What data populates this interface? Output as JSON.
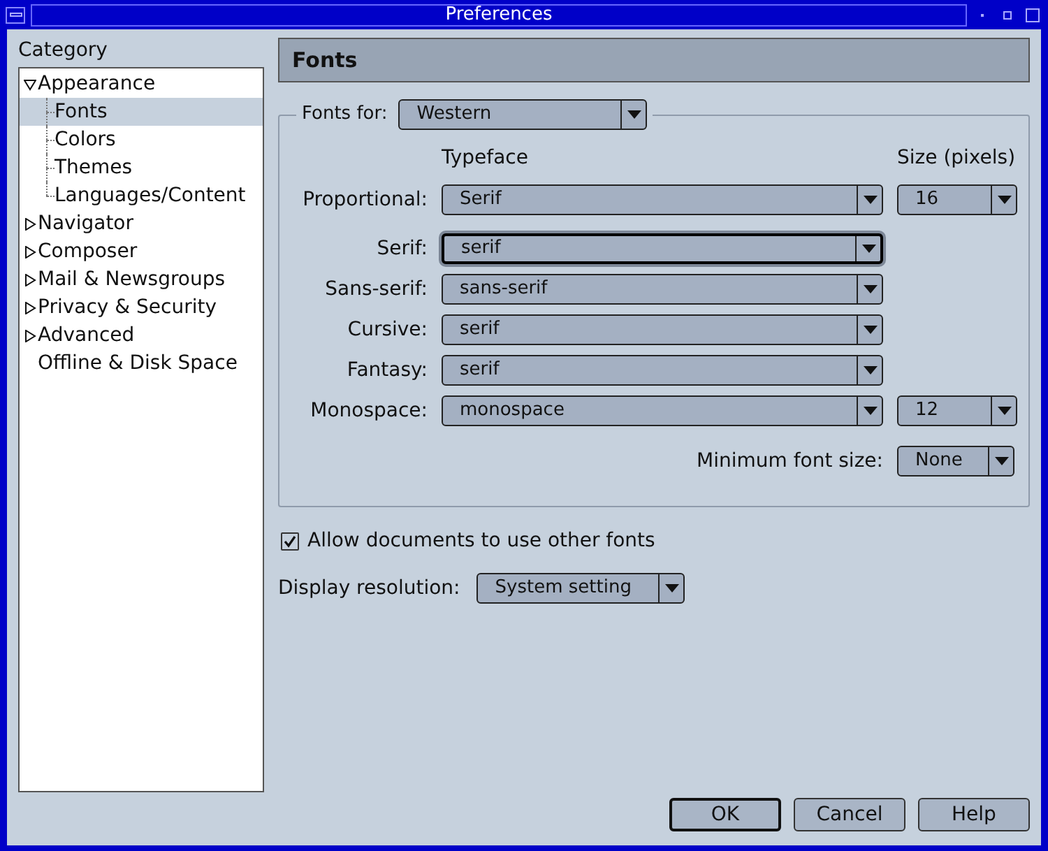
{
  "window": {
    "title": "Preferences"
  },
  "sidebar": {
    "label": "Category",
    "items": [
      {
        "label": "Appearance",
        "kind": "group",
        "expanded": true,
        "selected": false,
        "children": [
          {
            "label": "Fonts",
            "selected": true
          },
          {
            "label": "Colors",
            "selected": false
          },
          {
            "label": "Themes",
            "selected": false
          },
          {
            "label": "Languages/Content",
            "selected": false
          }
        ]
      },
      {
        "label": "Navigator",
        "kind": "group",
        "expanded": false,
        "selected": false
      },
      {
        "label": "Composer",
        "kind": "group",
        "expanded": false,
        "selected": false
      },
      {
        "label": "Mail & Newsgroups",
        "kind": "group",
        "expanded": false,
        "selected": false
      },
      {
        "label": "Privacy & Security",
        "kind": "group",
        "expanded": false,
        "selected": false
      },
      {
        "label": "Advanced",
        "kind": "group",
        "expanded": false,
        "selected": false
      },
      {
        "label": "Offline & Disk Space",
        "kind": "leaf",
        "selected": false
      }
    ]
  },
  "panel": {
    "title": "Fonts",
    "fonts_for": {
      "label": "Fonts for:",
      "value": "Western"
    },
    "typeface_header": "Typeface",
    "size_header": "Size (pixels)",
    "rows": [
      {
        "label": "Proportional:",
        "typeface": "Serif",
        "size": "16",
        "focused": false
      },
      {
        "label": "Serif:",
        "typeface": "serif",
        "focused": true
      },
      {
        "label": "Sans-serif:",
        "typeface": "sans-serif",
        "focused": false
      },
      {
        "label": "Cursive:",
        "typeface": "serif",
        "focused": false
      },
      {
        "label": "Fantasy:",
        "typeface": "serif",
        "focused": false
      },
      {
        "label": "Monospace:",
        "typeface": "monospace",
        "size": "12",
        "focused": false
      }
    ],
    "minimum_font_size": {
      "label": "Minimum font size:",
      "value": "None"
    },
    "allow_documents": {
      "label": "Allow documents to use other fonts",
      "checked": true
    },
    "display_resolution": {
      "label": "Display resolution:",
      "value": "System setting"
    }
  },
  "buttons": [
    {
      "label": "OK",
      "default": true
    },
    {
      "label": "Cancel",
      "default": false
    },
    {
      "label": "Help",
      "default": false
    }
  ]
}
